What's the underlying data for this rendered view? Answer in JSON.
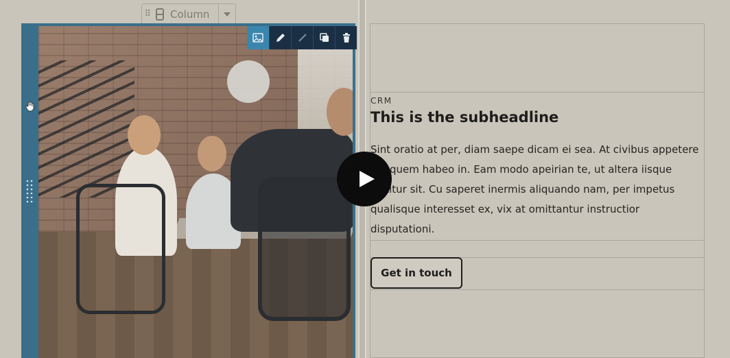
{
  "column_tab": {
    "label": "Column"
  },
  "content": {
    "eyebrow": "CRM",
    "subheadline": "This is the subheadline",
    "body": "Sint oratio at per, diam saepe dicam ei sea. At civibus appetere ea, quem habeo in. Eam modo apeirian te, ut altera iisque tortitur sit. Cu saperet inermis aliquando nam, per impetus qualisque interesset ex, vix at omittantur instructior disputationi.",
    "cta_label": "Get in touch"
  },
  "image_toolbar": [
    "image-icon",
    "pencil-icon",
    "brush-icon",
    "duplicate-icon",
    "trash-icon"
  ],
  "video_overlay": {
    "icon": "play-icon"
  },
  "colors": {
    "toolbar_bg": "#1b2f44",
    "toolbar_active": "#3a86ad",
    "column_outline": "#3a6f8c",
    "page_bg": "#c9c5ba",
    "text": "#1e1d1b"
  }
}
